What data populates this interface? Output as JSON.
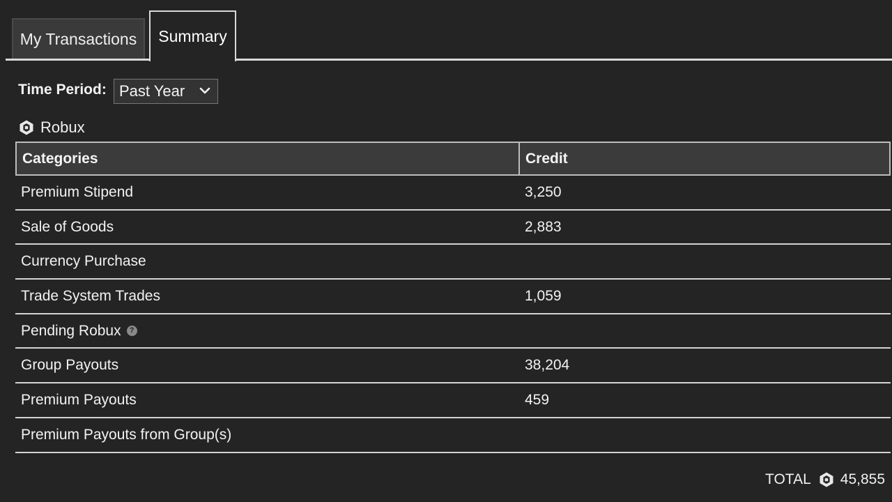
{
  "tabs": [
    {
      "label": "My Transactions",
      "active": false
    },
    {
      "label": "Summary",
      "active": true
    }
  ],
  "time_period": {
    "label": "Time Period:",
    "selected": "Past Year"
  },
  "currency": {
    "label": "Robux",
    "icon": "robux-icon"
  },
  "table": {
    "headers": [
      "Categories",
      "Credit"
    ],
    "rows": [
      {
        "category": "Premium Stipend",
        "credit": "3,250"
      },
      {
        "category": "Sale of Goods",
        "credit": "2,883"
      },
      {
        "category": "Currency Purchase",
        "credit": ""
      },
      {
        "category": "Trade System Trades",
        "credit": "1,059"
      },
      {
        "category": "Pending Robux",
        "credit": "",
        "help": "?"
      },
      {
        "category": "Group Payouts",
        "credit": "38,204"
      },
      {
        "category": "Premium Payouts",
        "credit": "459"
      },
      {
        "category": "Premium Payouts from Group(s)",
        "credit": ""
      }
    ]
  },
  "total": {
    "label": "TOTAL",
    "value": "45,855"
  },
  "colors": {
    "background": "#242424",
    "header_bg": "#3b3b3b",
    "inactive_tab_bg": "#3a3a3a",
    "rule": "#d4d4d4"
  }
}
